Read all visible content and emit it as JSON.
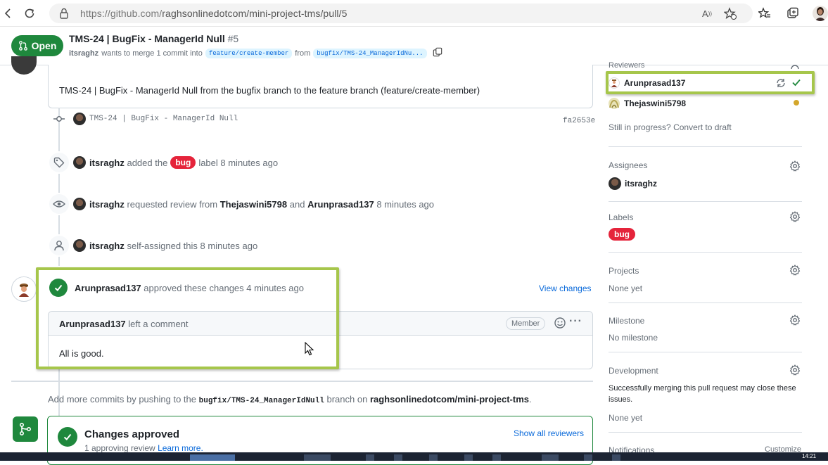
{
  "browser": {
    "url_host": "https://github.com/",
    "url_rest": "raghsonlinedotcom/mini-project-tms/pull/5"
  },
  "pr": {
    "state": "Open",
    "title": "TMS-24 | BugFix - ManagerId Null",
    "number": "#5",
    "author": "itsraghz",
    "merge_text_1": "wants to merge 1 commit into",
    "base_branch": "feature/create-member",
    "from_text": "from",
    "head_branch": "bugfix/TMS-24_ManagerIdNu...",
    "body": "TMS-24 | BugFix - ManagerId Null from the bugfix branch to the feature branch (feature/create-member)"
  },
  "timeline": {
    "commit": {
      "message": "TMS-24 | BugFix - ManagerId Null",
      "sha": "fa2653e"
    },
    "label_event": {
      "actor": "itsraghz",
      "text1": "added the",
      "label": "bug",
      "text2": "label 8 minutes ago"
    },
    "review_request": {
      "actor": "itsraghz",
      "text1": "requested review from",
      "user1": "Thejaswini5798",
      "and": "and",
      "user2": "Arunprasad137",
      "time": "8 minutes ago"
    },
    "self_assign": {
      "actor": "itsraghz",
      "text": "self-assigned this 8 minutes ago"
    },
    "review": {
      "reviewer": "Arunprasad137",
      "text": "approved these changes 4 minutes ago",
      "view_changes": "View changes",
      "comment_author": "Arunprasad137",
      "comment_meta": "left a comment",
      "member_badge": "Member",
      "comment_body": "All is good."
    },
    "push_hint": {
      "prefix": "Add more commits by pushing to the",
      "branch": "bugfix/TMS-24_ManagerIdNull",
      "mid": "branch on",
      "repo": "raghsonlinedotcom/mini-project-tms",
      "end": "."
    },
    "merge": {
      "title": "Changes approved",
      "sub": "1 approving review",
      "learn_more": "Learn more.",
      "show_all": "Show all reviewers"
    }
  },
  "sidebar": {
    "reviewers_heading": "Reviewers",
    "reviewers": [
      {
        "name": "Arunprasad137"
      },
      {
        "name": "Thejaswini5798"
      }
    ],
    "draft_text": "Still in progress?",
    "draft_link": "Convert to draft",
    "assignees_heading": "Assignees",
    "assignee": "itsraghz",
    "labels_heading": "Labels",
    "label": "bug",
    "projects_heading": "Projects",
    "projects_value": "None yet",
    "milestone_heading": "Milestone",
    "milestone_value": "No milestone",
    "development_heading": "Development",
    "development_text": "Successfully merging this pull request may close these issues.",
    "development_value": "None yet",
    "notifications_heading": "Notifications",
    "customize": "Customize"
  },
  "taskbar": {
    "clock": "14:21"
  },
  "colors": {
    "open_green": "#1f883d",
    "bug_red": "#e5243b",
    "link_blue": "#0969da",
    "highlight": "#a6c64b",
    "pending_orange": "#d4a72c"
  }
}
